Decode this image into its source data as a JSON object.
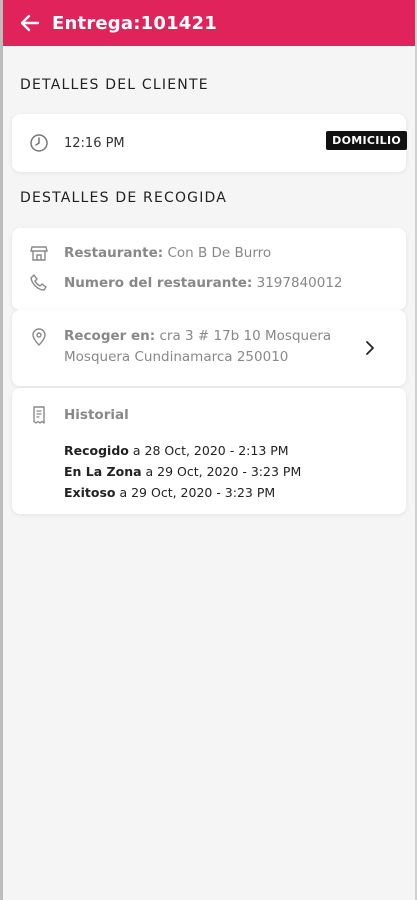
{
  "appbar": {
    "title": "Entrega:101421"
  },
  "customer": {
    "section_title": "DETALLES DEL CLIENTE",
    "time": "12:16 PM",
    "badge": "DOMICILIO"
  },
  "pickup": {
    "section_title": "DESTALLES DE RECOGIDA",
    "restaurant_label": "Restaurante:",
    "restaurant_value": "Con B De Burro",
    "phone_label": "Numero del restaurante:",
    "phone_value": "3197840012",
    "address_label": "Recoger en:",
    "address_value": "cra 3 # 17b 10 Mosquera Mosquera Cundinamarca 250010"
  },
  "history": {
    "title": "Historial",
    "items": [
      {
        "status": "Recogido",
        "text": "a 28 Oct, 2020 - 2:13 PM"
      },
      {
        "status": "En La Zona",
        "text": "a 29 Oct, 2020 - 3:23 PM"
      },
      {
        "status": "Exitoso",
        "text": "a 29 Oct, 2020 - 3:23 PM"
      }
    ]
  },
  "colors": {
    "accent": "#e0235a",
    "badge_bg": "#111111"
  },
  "icons": [
    "back-arrow-icon",
    "clock-icon",
    "store-icon",
    "phone-icon",
    "location-pin-icon",
    "chevron-right-icon",
    "receipt-icon"
  ]
}
